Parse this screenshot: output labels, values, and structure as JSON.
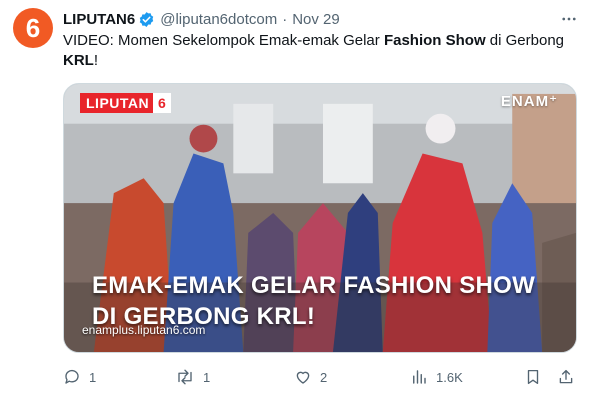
{
  "tweet": {
    "author": "LIPUTAN6",
    "handle": "@liputan6dotcom",
    "separator": "·",
    "time": "Nov 29",
    "text_before": "VIDEO: Momen Sekelompok Emak-emak Gelar ",
    "text_bold1": "Fashion Show",
    "text_mid": " di Gerbong ",
    "text_bold2": "KRL",
    "text_end": "!"
  },
  "media": {
    "brand_text": "LIPUTAN",
    "brand_digit": "6",
    "corner_brand": "ENAM⁺",
    "headline": "EMAK-EMAK GELAR FASHION SHOW DI GERBONG KRL!",
    "url": "enamplus.liputan6.com"
  },
  "actions": {
    "replies": "1",
    "reposts": "1",
    "likes": "2",
    "views": "1.6K"
  },
  "colors": {
    "brand_orange": "#f15a24",
    "brand_red": "#e8252b",
    "verified_blue": "#1d9bf0",
    "muted": "#536471"
  },
  "icons": [
    "avatar-logo",
    "verified-badge-icon",
    "more-icon",
    "reply-icon",
    "repost-icon",
    "like-icon",
    "views-icon",
    "bookmark-icon",
    "share-icon"
  ]
}
